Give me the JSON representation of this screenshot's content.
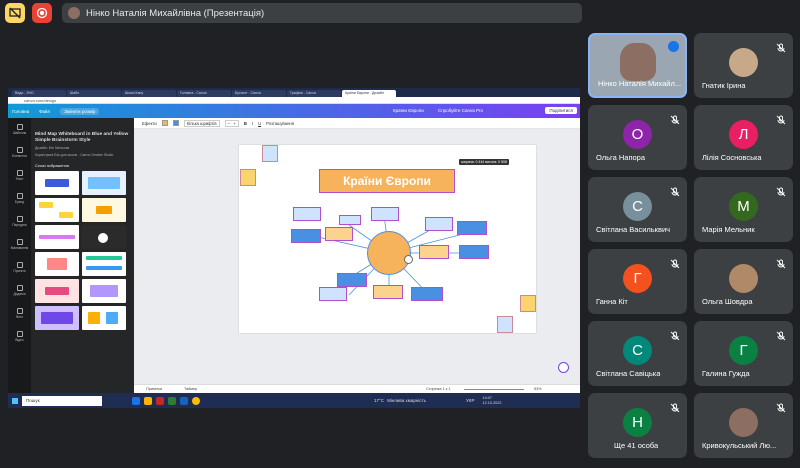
{
  "header": {
    "presenter": "Нінко Наталія Михайлівна (Презентація)"
  },
  "colors": {
    "accent_yellow": "#f9ab00",
    "record_red": "#ea4335",
    "tile_bg": "#3c4043",
    "bg": "#202124"
  },
  "screen": {
    "tabs": [
      "Види - ЗНО",
      "Шабл",
      "Шкалі Кану",
      "Головна - Canva",
      "Бухгалт - Canva",
      "Графіки - Canva",
      "Країни Європи - Дизайн"
    ],
    "canva": {
      "home": "Головна",
      "file": "Файл",
      "resize": "Змінити розмір",
      "title": "Країни Європи",
      "try_pro": "Спробуйте Canva Pro",
      "share": "Поділитися"
    },
    "rail": [
      "Шаблони",
      "Елементи",
      "Текст",
      "Бренд",
      "Передати",
      "Малювання",
      "Проєкти",
      "Додатки",
      "Фото",
      "Відео"
    ],
    "panel": {
      "title": "Mind Map Whiteboard in Blue and Yellow Simple Brainstorm Style",
      "design_by": "Дизайн: Біті Мельник",
      "note": "Користувачі Edu-для школи - Canva Creative Studio",
      "section": "Схожі зображення"
    },
    "toolbar": {
      "effects": "Ефекти",
      "font": "Кілька шрифтів",
      "position": "Розташування"
    },
    "board": {
      "title": "Країни Європи",
      "tooltip": "ширина: 0 444 висота: 0 508"
    },
    "bottom": {
      "notes": "Примітки",
      "timer": "Таймер",
      "page": "Сторінка 1 з 1",
      "zoom": "53%"
    },
    "taskbar": {
      "search": "Пошук",
      "weather": "17°C",
      "weather_desc": "Мінлива хмарність",
      "lang": "УКР",
      "time": "14:07",
      "date": "12.10.2022"
    }
  },
  "participants": [
    {
      "name": "Нінко Наталія Михайл...",
      "initial": "",
      "color": "#8d6e63",
      "video": true,
      "speaking": true
    },
    {
      "name": "Гнатик Ірина",
      "initial": "",
      "color": "#c7a98a",
      "photo": true
    },
    {
      "name": "Ольга Напора",
      "initial": "О",
      "color": "#8e24aa"
    },
    {
      "name": "Лілія Сосновська",
      "initial": "Л",
      "color": "#e91e63"
    },
    {
      "name": "Світлана Васильквич",
      "initial": "С",
      "color": "#78909c"
    },
    {
      "name": "Марія Мельник",
      "initial": "М",
      "color": "#33691e"
    },
    {
      "name": "Ганна Кіт",
      "initial": "Г",
      "color": "#f4511e"
    },
    {
      "name": "Ольга Шовдра",
      "initial": "",
      "color": "#b08968",
      "photo": true
    },
    {
      "name": "Світлана Савіцька",
      "initial": "С",
      "color": "#00897b"
    },
    {
      "name": "Галина Гужда",
      "initial": "Г",
      "color": "#0b8043"
    },
    {
      "name": "Ще 41 особа",
      "initial": "Н",
      "color": "#0b8043"
    },
    {
      "name": "Кривокульський Лю...",
      "initial": "",
      "color": "#8d6e63",
      "photo": true
    }
  ]
}
